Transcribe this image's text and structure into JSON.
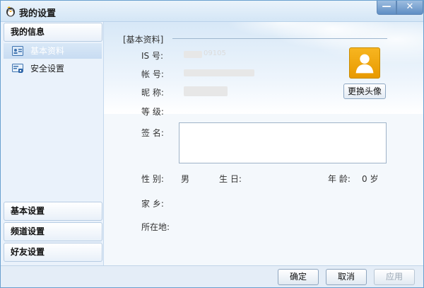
{
  "window": {
    "title": "我的设置",
    "minimize_glyph": "—",
    "close_glyph": "✕"
  },
  "sidebar": {
    "my_info": "我的信息",
    "items": [
      {
        "label": "基本资料",
        "icon": "id-card-icon",
        "selected": true
      },
      {
        "label": "安全设置",
        "icon": "security-icon",
        "selected": false
      }
    ],
    "basic_settings": "基本设置",
    "channel_settings": "频道设置",
    "friend_settings": "好友设置"
  },
  "profile": {
    "section_title": "[基本资料]",
    "is_label": "IS 号:",
    "is_value_partial": "09105",
    "account_label": "帐 号:",
    "nickname_label": "昵 称:",
    "level_label": "等 级:",
    "signature_label": "签 名:",
    "gender_label": "性 别:",
    "gender_value": "男",
    "birthday_label": "生 日:",
    "age_label": "年 龄:",
    "age_value": "0 岁",
    "hometown_label": "家 乡:",
    "location_label": "所在地:",
    "change_avatar": "更换头像"
  },
  "footer": {
    "ok": "确定",
    "cancel": "取消",
    "apply": "应用"
  },
  "colors": {
    "accent": "#5f8ec4",
    "avatar": "#f0a500"
  }
}
